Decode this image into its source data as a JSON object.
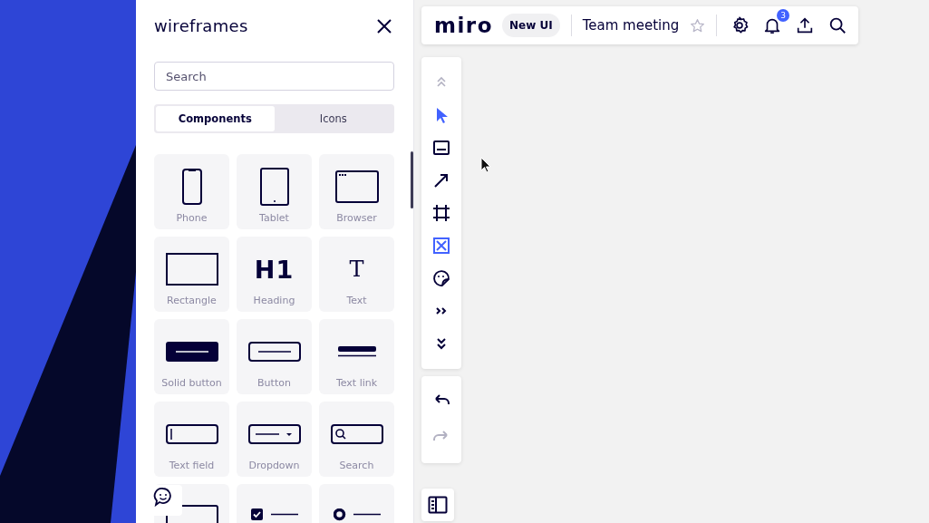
{
  "panel": {
    "title": "wireframes",
    "search": {
      "placeholder": "Search"
    },
    "tabs": [
      {
        "label": "Components",
        "selected": true
      },
      {
        "label": "Icons",
        "selected": false
      }
    ],
    "component_rows": [
      [
        {
          "kind": "phone",
          "label": "Phone"
        },
        {
          "kind": "tablet",
          "label": "Tablet"
        },
        {
          "kind": "browser",
          "label": "Browser"
        }
      ],
      [
        {
          "kind": "rectangle",
          "label": "Rectangle"
        },
        {
          "kind": "heading",
          "glyph": "H1",
          "label": "Heading"
        },
        {
          "kind": "text",
          "glyph": "T",
          "label": "Text"
        }
      ],
      [
        {
          "kind": "solid-button",
          "label": "Solid button"
        },
        {
          "kind": "button",
          "label": "Button"
        },
        {
          "kind": "text-link",
          "label": "Text link"
        }
      ],
      [
        {
          "kind": "text-field",
          "label": "Text field"
        },
        {
          "kind": "dropdown",
          "label": "Dropdown"
        },
        {
          "kind": "search",
          "label": "Search"
        }
      ],
      [
        {
          "kind": "textarea"
        },
        {
          "kind": "checkbox-list"
        },
        {
          "kind": "radio-list"
        }
      ]
    ]
  },
  "topbar": {
    "logo": "miro",
    "tag": "New UI",
    "board": "Team meeting",
    "starred": false,
    "notifications": "3"
  },
  "toolbar": {
    "tools": [
      {
        "kind": "collapse",
        "selected": false,
        "disabled": true
      },
      {
        "kind": "select",
        "selected": true,
        "disabled": false
      },
      {
        "kind": "sticky",
        "selected": false,
        "disabled": false
      },
      {
        "kind": "arrow",
        "selected": false,
        "disabled": false
      },
      {
        "kind": "frame",
        "selected": false,
        "disabled": false
      },
      {
        "kind": "wireframe",
        "selected": true,
        "disabled": false
      },
      {
        "kind": "sticker",
        "selected": false,
        "disabled": false
      },
      {
        "kind": "more",
        "selected": false,
        "disabled": false
      },
      {
        "kind": "expand",
        "selected": false,
        "disabled": false
      }
    ],
    "history": [
      {
        "kind": "undo",
        "disabled": false
      },
      {
        "kind": "redo",
        "disabled": true
      }
    ]
  }
}
